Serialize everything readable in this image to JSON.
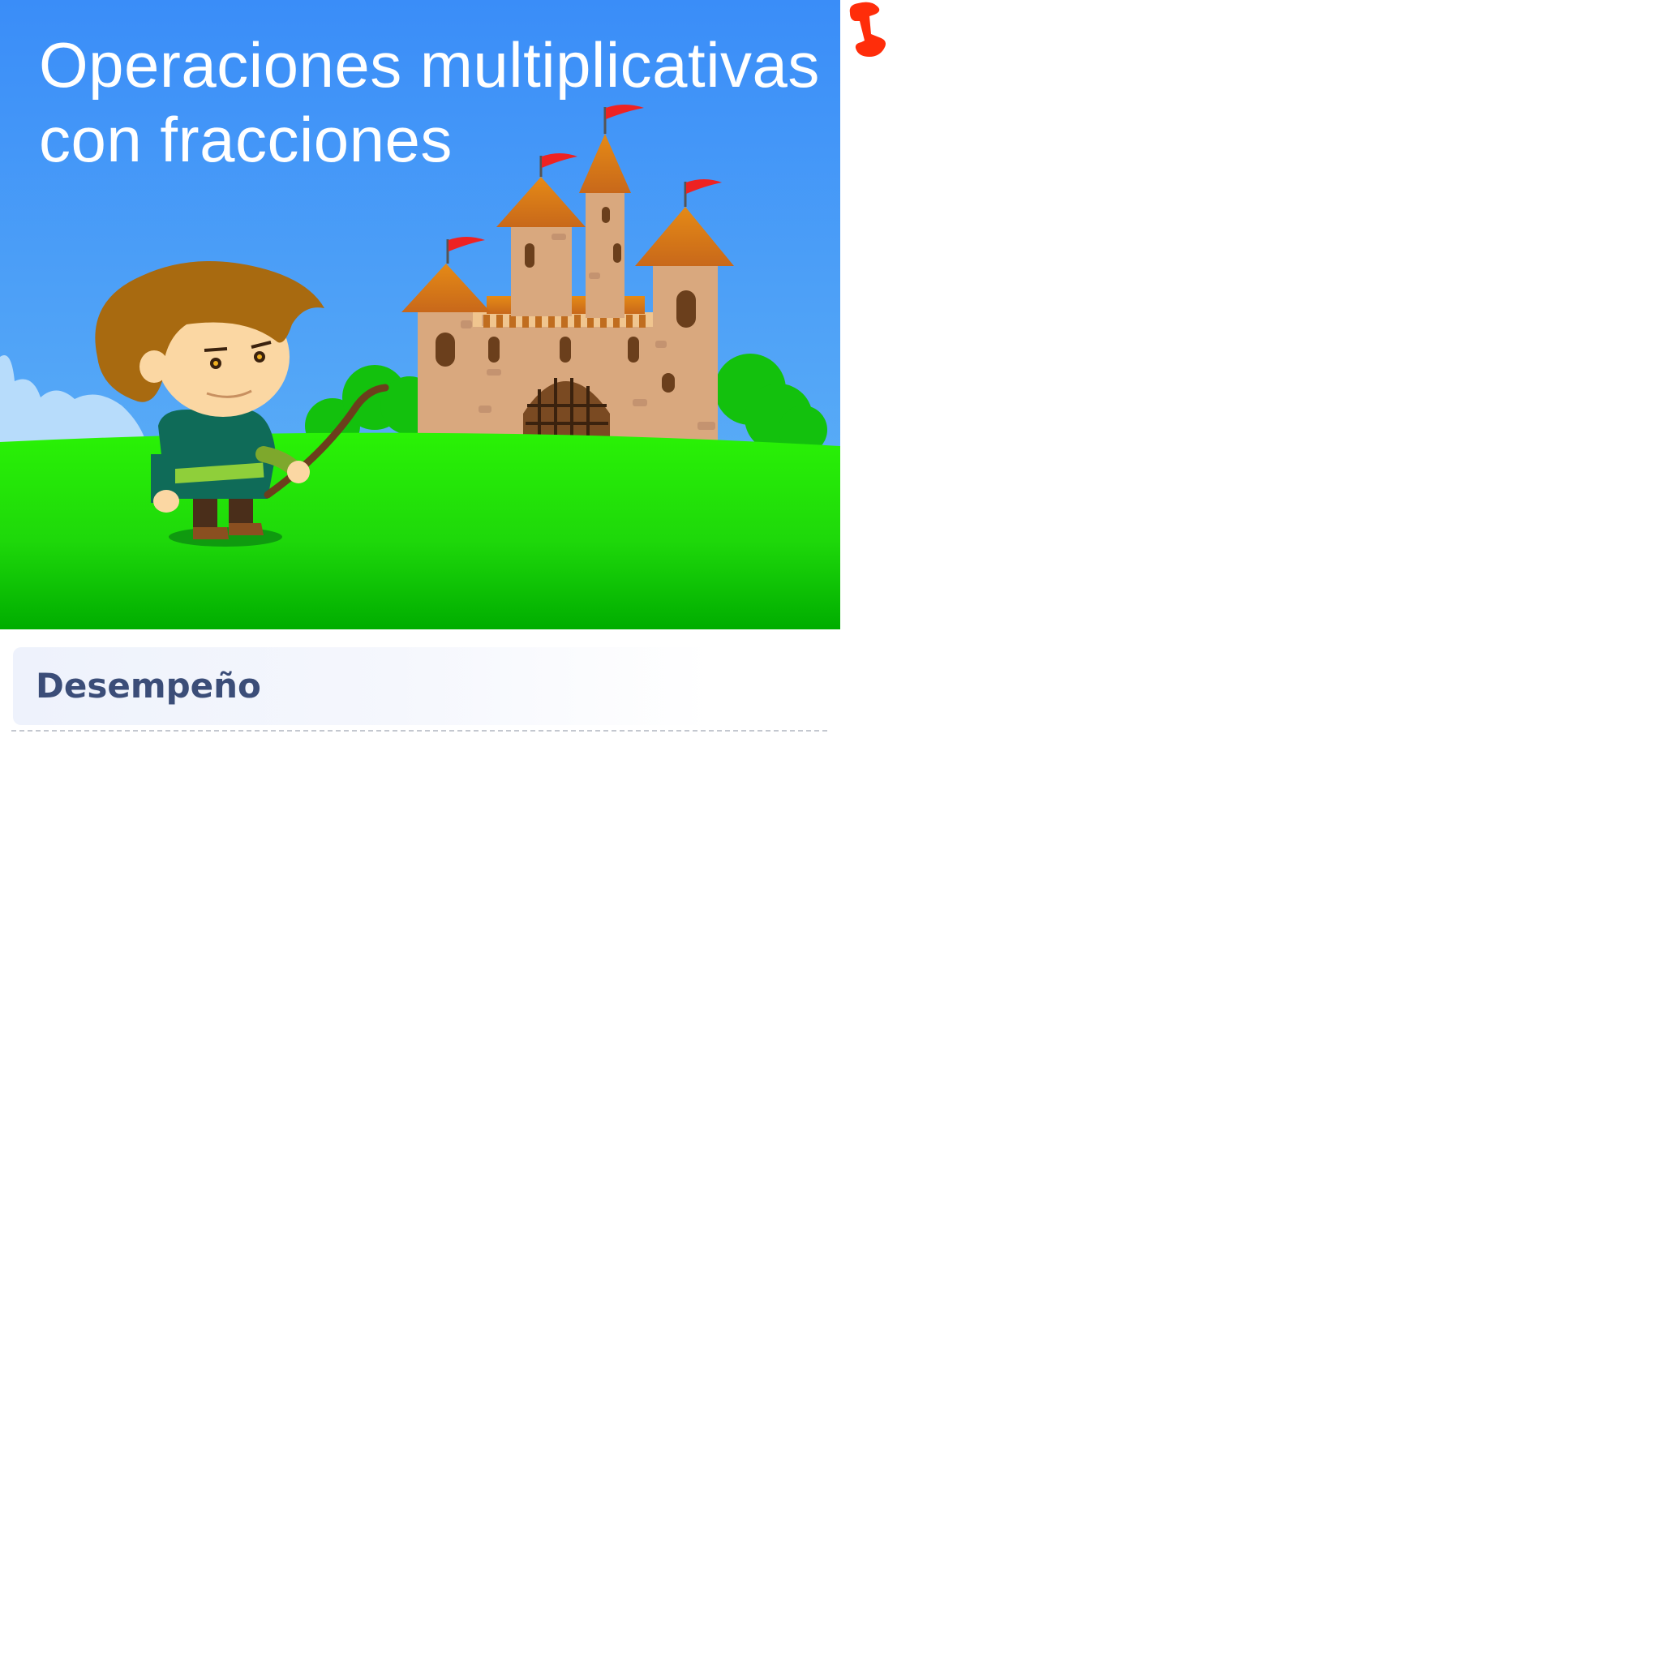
{
  "hero": {
    "title": "Operaciones multiplicativas con fracciones"
  },
  "section": {
    "title": "Desempeño"
  },
  "icons": {
    "pin": "pushpin-icon"
  },
  "colors": {
    "sky_top": "#3a8df8",
    "sky_bottom": "#63b6f6",
    "grass_top": "#2af206",
    "grass_bottom": "#00ad00",
    "section_title": "#3b4d78",
    "pin": "#ff2d0a"
  }
}
